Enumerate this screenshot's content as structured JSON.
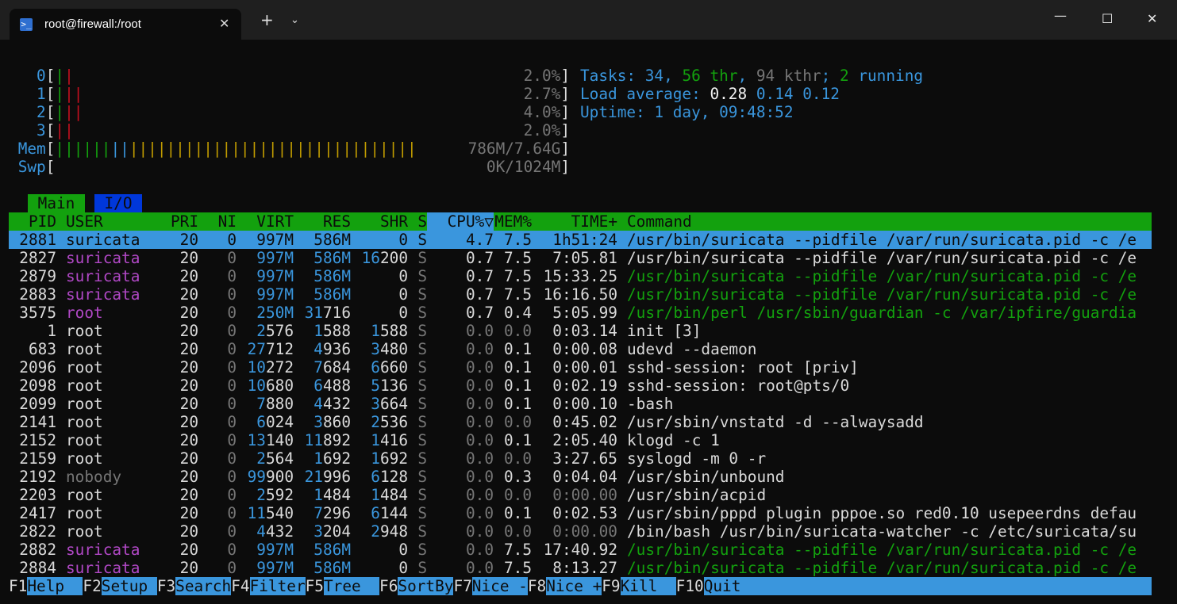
{
  "window": {
    "tab_title": "root@firewall:/root",
    "tab_icon": "powershell-icon",
    "new_tab": "+",
    "dropdown": "⌄",
    "minimize": "—",
    "maximize": "☐",
    "close": "✕"
  },
  "meters": {
    "cpus": [
      {
        "label": "0",
        "value": "2.0%"
      },
      {
        "label": "1",
        "value": "2.7%"
      },
      {
        "label": "2",
        "value": "4.0%"
      },
      {
        "label": "3",
        "value": "2.0%"
      }
    ],
    "mem": {
      "label": "Mem",
      "value": "786M/7.64G"
    },
    "swp": {
      "label": "Swp",
      "value": "0K/1024M"
    }
  },
  "summary": {
    "tasks_label": "Tasks: ",
    "tasks": "34",
    "thr": "56",
    "thr_label": " thr",
    "kthr": "94",
    "kthr_label": " kthr",
    "running": "2",
    "running_label": " running",
    "load_label": "Load average: ",
    "load1": "0.28",
    "load5": "0.14",
    "load15": "0.12",
    "uptime_label": "Uptime: ",
    "uptime": "1 day, 09:48:52"
  },
  "screen_tabs": [
    "Main",
    "I/O"
  ],
  "columns": [
    "PID",
    "USER",
    "PRI",
    "NI",
    "VIRT",
    "RES",
    "SHR",
    "S",
    "CPU%▽",
    "MEM%",
    "TIME+",
    "Command"
  ],
  "processes": [
    {
      "pid": "2881",
      "user": "suricata",
      "pri": "20",
      "ni": "0",
      "virt": "997M",
      "res": "586M",
      "shr": "0",
      "s": "S",
      "cpu": "4.7",
      "mem": "7.5",
      "time": "1h51:24",
      "cmd": "/usr/bin/suricata --pidfile /var/run/suricata.pid -c /e"
    },
    {
      "pid": "2827",
      "user": "suricata",
      "pri": "20",
      "ni": "0",
      "virt": "997M",
      "res": "586M",
      "shr": "16200",
      "s": "S",
      "cpu": "0.7",
      "mem": "7.5",
      "time": "7:05.81",
      "cmd": "/usr/bin/suricata --pidfile /var/run/suricata.pid -c /e"
    },
    {
      "pid": "2879",
      "user": "suricata",
      "pri": "20",
      "ni": "0",
      "virt": "997M",
      "res": "586M",
      "shr": "0",
      "s": "S",
      "cpu": "0.7",
      "mem": "7.5",
      "time": "15:33.25",
      "cmd": "/usr/bin/suricata --pidfile /var/run/suricata.pid -c /e"
    },
    {
      "pid": "2883",
      "user": "suricata",
      "pri": "20",
      "ni": "0",
      "virt": "997M",
      "res": "586M",
      "shr": "0",
      "s": "S",
      "cpu": "0.7",
      "mem": "7.5",
      "time": "16:16.50",
      "cmd": "/usr/bin/suricata --pidfile /var/run/suricata.pid -c /e"
    },
    {
      "pid": "3575",
      "user": "root",
      "pri": "20",
      "ni": "0",
      "virt": "250M",
      "res": "31716",
      "shr": "0",
      "s": "S",
      "cpu": "0.7",
      "mem": "0.4",
      "time": "5:05.99",
      "cmd": "/usr/bin/perl /usr/sbin/guardian -c /var/ipfire/guardia"
    },
    {
      "pid": "1",
      "user": "root",
      "pri": "20",
      "ni": "0",
      "virt": "2576",
      "res": "1588",
      "shr": "1588",
      "s": "S",
      "cpu": "0.0",
      "mem": "0.0",
      "time": "0:03.14",
      "cmd": "init [3]"
    },
    {
      "pid": "683",
      "user": "root",
      "pri": "20",
      "ni": "0",
      "virt": "27712",
      "res": "4936",
      "shr": "3480",
      "s": "S",
      "cpu": "0.0",
      "mem": "0.1",
      "time": "0:00.08",
      "cmd": "udevd --daemon"
    },
    {
      "pid": "2096",
      "user": "root",
      "pri": "20",
      "ni": "0",
      "virt": "10272",
      "res": "7684",
      "shr": "6660",
      "s": "S",
      "cpu": "0.0",
      "mem": "0.1",
      "time": "0:00.01",
      "cmd": "sshd-session: root [priv]"
    },
    {
      "pid": "2098",
      "user": "root",
      "pri": "20",
      "ni": "0",
      "virt": "10680",
      "res": "6488",
      "shr": "5136",
      "s": "S",
      "cpu": "0.0",
      "mem": "0.1",
      "time": "0:02.19",
      "cmd": "sshd-session: root@pts/0"
    },
    {
      "pid": "2099",
      "user": "root",
      "pri": "20",
      "ni": "0",
      "virt": "7880",
      "res": "4432",
      "shr": "3664",
      "s": "S",
      "cpu": "0.0",
      "mem": "0.1",
      "time": "0:00.10",
      "cmd": "-bash"
    },
    {
      "pid": "2141",
      "user": "root",
      "pri": "20",
      "ni": "0",
      "virt": "6024",
      "res": "3860",
      "shr": "2536",
      "s": "S",
      "cpu": "0.0",
      "mem": "0.0",
      "time": "0:45.02",
      "cmd": "/usr/sbin/vnstatd -d --alwaysadd"
    },
    {
      "pid": "2152",
      "user": "root",
      "pri": "20",
      "ni": "0",
      "virt": "13140",
      "res": "11892",
      "shr": "1416",
      "s": "S",
      "cpu": "0.0",
      "mem": "0.1",
      "time": "2:05.40",
      "cmd": "klogd -c 1"
    },
    {
      "pid": "2159",
      "user": "root",
      "pri": "20",
      "ni": "0",
      "virt": "2564",
      "res": "1692",
      "shr": "1692",
      "s": "S",
      "cpu": "0.0",
      "mem": "0.0",
      "time": "3:27.65",
      "cmd": "syslogd -m 0 -r"
    },
    {
      "pid": "2192",
      "user": "nobody",
      "pri": "20",
      "ni": "0",
      "virt": "99900",
      "res": "21996",
      "shr": "6128",
      "s": "S",
      "cpu": "0.0",
      "mem": "0.3",
      "time": "0:04.04",
      "cmd": "/usr/sbin/unbound"
    },
    {
      "pid": "2203",
      "user": "root",
      "pri": "20",
      "ni": "0",
      "virt": "2592",
      "res": "1484",
      "shr": "1484",
      "s": "S",
      "cpu": "0.0",
      "mem": "0.0",
      "time": "0:00.00",
      "cmd": "/usr/sbin/acpid"
    },
    {
      "pid": "2417",
      "user": "root",
      "pri": "20",
      "ni": "0",
      "virt": "11540",
      "res": "7296",
      "shr": "6144",
      "s": "S",
      "cpu": "0.0",
      "mem": "0.1",
      "time": "0:02.53",
      "cmd": "/usr/sbin/pppd plugin pppoe.so red0.10 usepeerdns defau"
    },
    {
      "pid": "2822",
      "user": "root",
      "pri": "20",
      "ni": "0",
      "virt": "4432",
      "res": "3204",
      "shr": "2948",
      "s": "S",
      "cpu": "0.0",
      "mem": "0.0",
      "time": "0:00.00",
      "cmd": "/bin/bash /usr/bin/suricata-watcher -c /etc/suricata/su"
    },
    {
      "pid": "2882",
      "user": "suricata",
      "pri": "20",
      "ni": "0",
      "virt": "997M",
      "res": "586M",
      "shr": "0",
      "s": "S",
      "cpu": "0.0",
      "mem": "7.5",
      "time": "17:40.92",
      "cmd": "/usr/bin/suricata --pidfile /var/run/suricata.pid -c /e"
    },
    {
      "pid": "2884",
      "user": "suricata",
      "pri": "20",
      "ni": "0",
      "virt": "997M",
      "res": "586M",
      "shr": "0",
      "s": "S",
      "cpu": "0.0",
      "mem": "7.5",
      "time": "8:13.27",
      "cmd": "/usr/bin/suricata --pidfile /var/run/suricata.pid -c /e"
    }
  ],
  "fkeys": [
    {
      "key": "F1",
      "label": "Help  "
    },
    {
      "key": "F2",
      "label": "Setup "
    },
    {
      "key": "F3",
      "label": "Search"
    },
    {
      "key": "F4",
      "label": "Filter"
    },
    {
      "key": "F5",
      "label": "Tree  "
    },
    {
      "key": "F6",
      "label": "SortBy"
    },
    {
      "key": "F7",
      "label": "Nice -"
    },
    {
      "key": "F8",
      "label": "Nice +"
    },
    {
      "key": "F9",
      "label": "Kill  "
    },
    {
      "key": "F10",
      "label": "Quit"
    }
  ],
  "colors": {
    "background": "#0c0c0c",
    "header_green": "#13a10e",
    "selection_blue": "#3a96dd",
    "suricata_magenta": "#b148c6"
  }
}
